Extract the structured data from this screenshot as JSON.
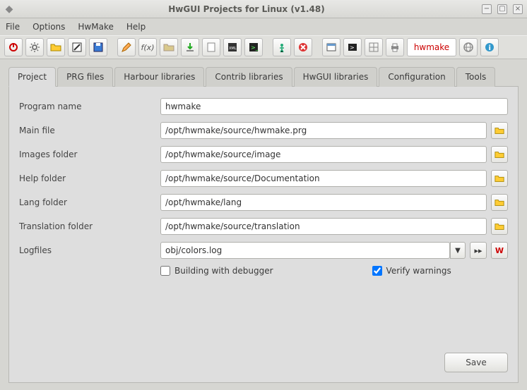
{
  "window": {
    "title": "HwGUI Projects for Linux (v1.48)"
  },
  "menu": {
    "file": "File",
    "options": "Options",
    "hwmake": "HwMake",
    "help": "Help"
  },
  "brand": "hwmake",
  "tabs": [
    "Project",
    "PRG files",
    "Harbour libraries",
    "Contrib libraries",
    "HwGUI libraries",
    "Configuration",
    "Tools"
  ],
  "form": {
    "program_name": {
      "label": "Program name",
      "value": "hwmake"
    },
    "main_file": {
      "label": "Main file",
      "value": "/opt/hwmake/source/hwmake.prg"
    },
    "images_folder": {
      "label": "Images folder",
      "value": "/opt/hwmake/source/image"
    },
    "help_folder": {
      "label": "Help folder",
      "value": "/opt/hwmake/source/Documentation"
    },
    "lang_folder": {
      "label": "Lang folder",
      "value": "/opt/hwmake/lang"
    },
    "translation_folder": {
      "label": "Translation folder",
      "value": "/opt/hwmake/source/translation"
    },
    "logfiles": {
      "label": "Logfiles",
      "value": "obj/colors.log"
    }
  },
  "checks": {
    "debugger": {
      "label": "Building with debugger",
      "checked": false
    },
    "warnings": {
      "label": "Verify warnings",
      "checked": true
    }
  },
  "buttons": {
    "save": "Save",
    "w": "W",
    "next": "▸▸"
  }
}
